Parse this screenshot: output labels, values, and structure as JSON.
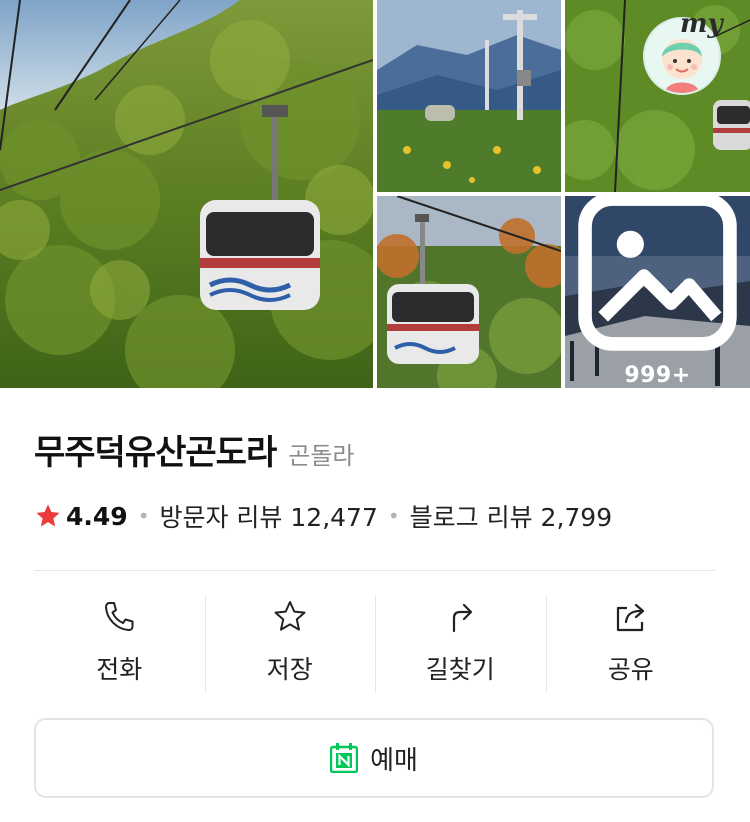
{
  "gallery": {
    "more_count": "999+",
    "badge_text": "my"
  },
  "place": {
    "name": "무주덕유산곤도라",
    "category": "곤돌라"
  },
  "rating": {
    "score": "4.49",
    "visitor_reviews": "방문자 리뷰 12,477",
    "blog_reviews": "블로그 리뷰 2,799",
    "star_color": "#ea3b3b"
  },
  "actions": [
    {
      "label": "전화",
      "icon": "phone-icon"
    },
    {
      "label": "저장",
      "icon": "star-outline-icon"
    },
    {
      "label": "길찾기",
      "icon": "route-arrow-icon"
    },
    {
      "label": "공유",
      "icon": "share-icon"
    }
  ],
  "reserve": {
    "label": "예매",
    "icon": "naver-booking-icon",
    "accent": "#03c75a"
  }
}
